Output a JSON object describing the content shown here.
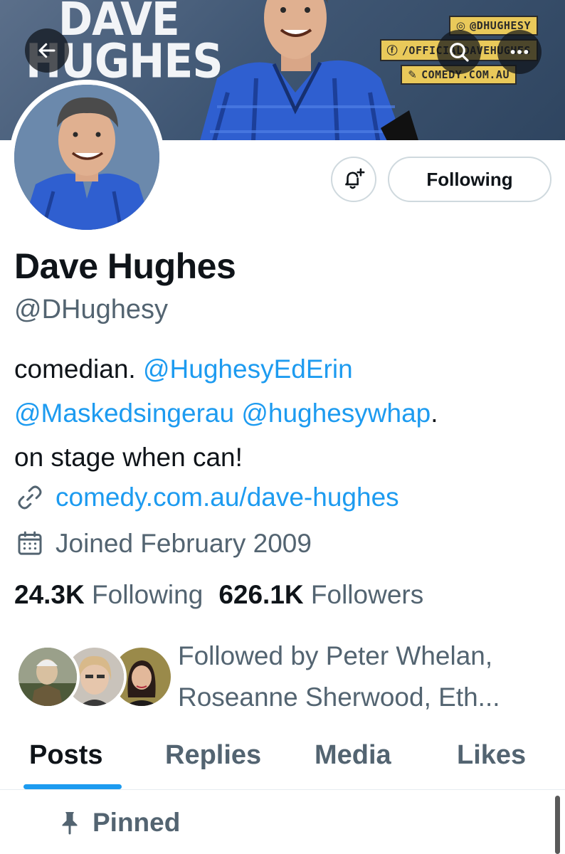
{
  "banner": {
    "brand_line1": "DAVE",
    "brand_line2": "HUGHES",
    "socials": [
      "@DHUGHESY",
      "/OFFICIALDAVEHUGHES",
      "COMEDY.COM.AU"
    ]
  },
  "profile": {
    "name": "Dave Hughes",
    "handle": "@DHughesy",
    "bio": {
      "text1": "comedian. ",
      "mention1": "@HughesyEdErin",
      "mention2": "@Maskedsingerau",
      "mention3": "@hughesywhap",
      "text2": ".",
      "text3": "on stage when can!"
    },
    "link": "comedy.com.au/dave-hughes",
    "joined": "Joined February 2009",
    "following_count": "24.3K",
    "following_label": "Following",
    "followers_count": "626.1K",
    "followers_label": "Followers",
    "followed_by": "Followed by Peter Whelan, Roseanne Sherwood, Eth..."
  },
  "actions": {
    "follow_label": "Following"
  },
  "tabs": [
    "Posts",
    "Replies",
    "Media",
    "Likes"
  ],
  "pinned_label": "Pinned",
  "colors": {
    "accent": "#1d9bf0",
    "text": "#0f1419",
    "muted": "#536471"
  }
}
